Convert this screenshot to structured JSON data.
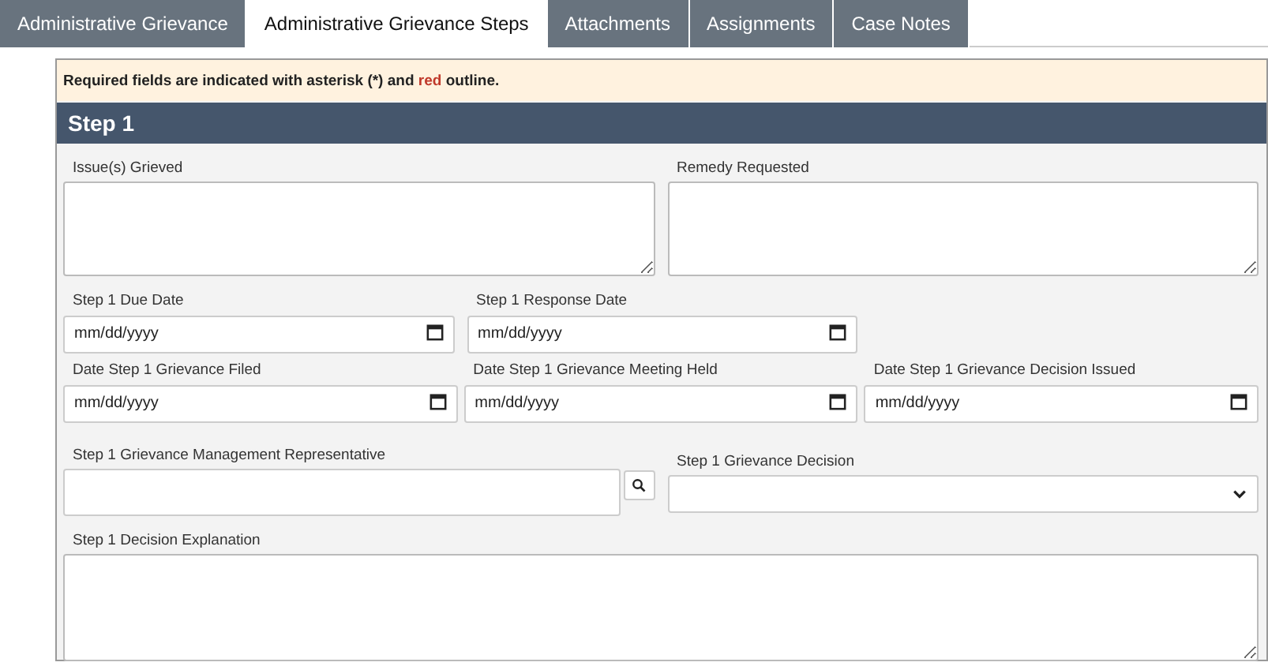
{
  "tabs": [
    {
      "label": "Administrative Grievance",
      "selected": false
    },
    {
      "label": "Administrative Grievance Steps",
      "selected": true
    },
    {
      "label": "Attachments",
      "selected": false
    },
    {
      "label": "Assignments",
      "selected": false
    },
    {
      "label": "Case Notes",
      "selected": false
    }
  ],
  "notice": [
    {
      "text": "Required fields are indicated with asterisk (*) and ",
      "kind": "plain"
    },
    {
      "text": "red",
      "kind": "alert"
    },
    {
      "text": " outline.",
      "kind": "plain"
    }
  ],
  "section": {
    "title": "Step 1",
    "rows": [
      [
        {
          "label": "Issue(s) Grieved",
          "kind": "textarea"
        },
        {
          "label": "Remedy Requested",
          "kind": "textarea"
        }
      ],
      [
        {
          "label": "Step 1 Due Date",
          "kind": "date",
          "placeholder": "mm/dd/yyyy"
        },
        {
          "label": "Step 1 Response Date",
          "kind": "date",
          "placeholder": "mm/dd/yyyy"
        }
      ],
      [
        {
          "label": "Date Step 1 Grievance Filed",
          "kind": "date",
          "placeholder": "mm/dd/yyyy"
        },
        {
          "label": "Date Step 1 Grievance Meeting Held",
          "kind": "date",
          "placeholder": "mm/dd/yyyy"
        },
        {
          "label": "Date Step 1 Grievance Decision Issued",
          "kind": "date",
          "placeholder": "mm/dd/yyyy"
        }
      ],
      [
        {
          "label": "Step 1 Grievance Management Representative",
          "kind": "lookup"
        },
        {
          "label": "Step 1 Grievance Decision",
          "kind": "select"
        }
      ],
      [
        {
          "label": "Step 1 Decision Explanation",
          "kind": "textarea"
        }
      ]
    ]
  }
}
